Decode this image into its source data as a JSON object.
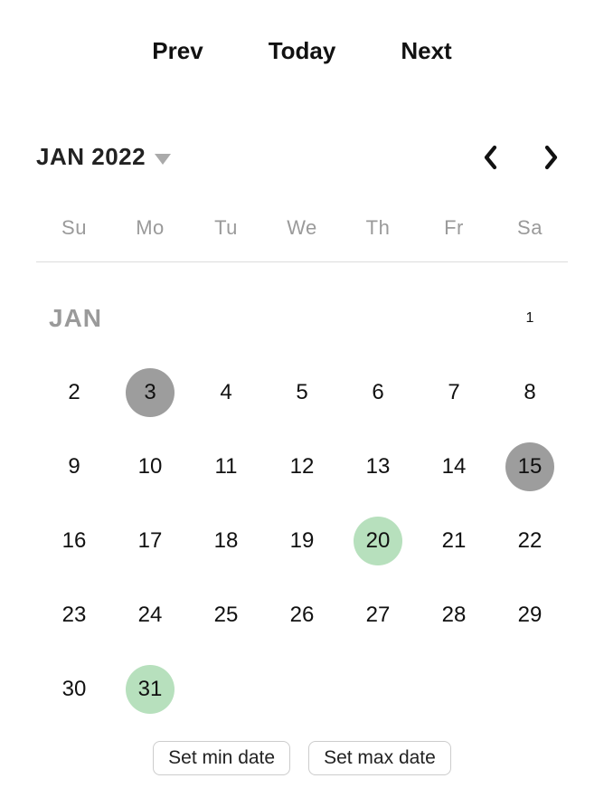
{
  "topbar": {
    "prev": "Prev",
    "today": "Today",
    "next": "Next"
  },
  "header": {
    "month_year": "JAN 2022"
  },
  "weekdays": [
    "Su",
    "Mo",
    "Tu",
    "We",
    "Th",
    "Fr",
    "Sa"
  ],
  "month_label": "JAN",
  "first_row": {
    "label": "JAN",
    "day": "1"
  },
  "weeks": [
    [
      "2",
      "3",
      "4",
      "5",
      "6",
      "7",
      "8"
    ],
    [
      "9",
      "10",
      "11",
      "12",
      "13",
      "14",
      "15"
    ],
    [
      "16",
      "17",
      "18",
      "19",
      "20",
      "21",
      "22"
    ],
    [
      "23",
      "24",
      "25",
      "26",
      "27",
      "28",
      "29"
    ],
    [
      "30",
      "31",
      "",
      "",
      "",
      "",
      ""
    ]
  ],
  "selected_days": [
    "3",
    "15"
  ],
  "highlighted_days": [
    "20",
    "31"
  ],
  "footer": {
    "set_min": "Set min date",
    "set_max": "Set max date"
  }
}
